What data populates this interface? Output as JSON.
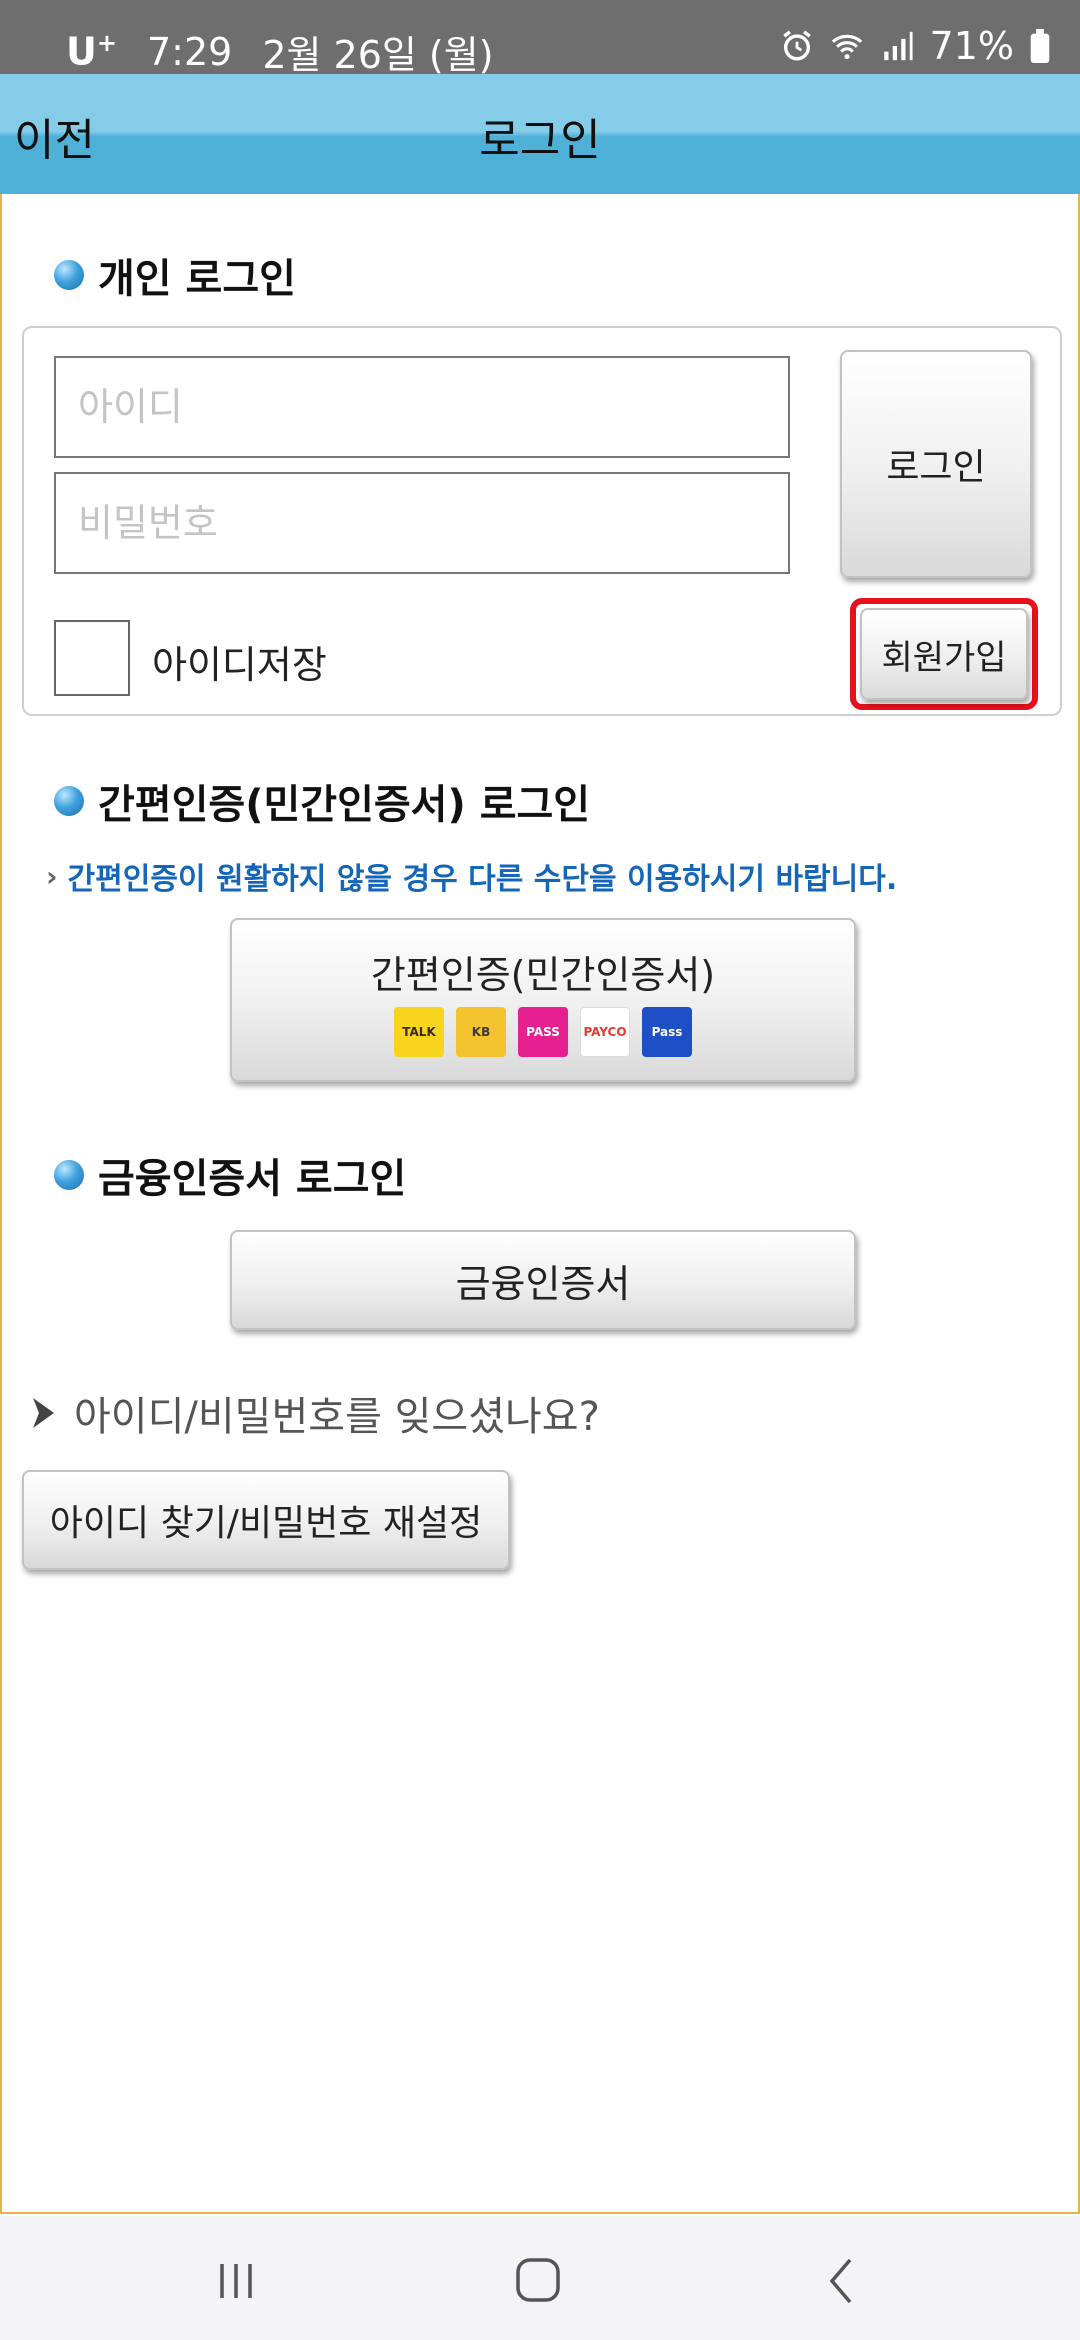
{
  "status_bar": {
    "carrier": "U",
    "carrier_sup": "+",
    "time": "7:29",
    "date": "2월 26일 (월)",
    "battery": "71%"
  },
  "header": {
    "back_label": "이전",
    "title": "로그인"
  },
  "personal_login": {
    "heading": "개인 로그인",
    "id_placeholder": "아이디",
    "password_placeholder": "비밀번호",
    "login_button": "로그인",
    "save_id_label": "아이디저장",
    "signup_button": "회원가입"
  },
  "simple_auth": {
    "heading": "간편인증(민간인증서) 로그인",
    "notice": "간편인증이 원활하지 않을 경우 다른 수단을 이용하시기 바랍니다.",
    "button_label": "간편인증(민간인증서)",
    "provider_icons": [
      {
        "name": "kakao-talk-icon",
        "text": "TALK",
        "bg": "#f7d51d",
        "fg": "#3a2a1a"
      },
      {
        "name": "kb-icon",
        "text": "KB",
        "bg": "#f4c430",
        "fg": "#3b3b3b"
      },
      {
        "name": "pass-icon",
        "text": "PASS",
        "bg": "#e6208f",
        "fg": "#ffffff"
      },
      {
        "name": "payco-icon",
        "text": "PAYCO",
        "bg": "#ffffff",
        "fg": "#e53935"
      },
      {
        "name": "samsung-pass-icon",
        "text": "Pass",
        "bg": "#1f4fc4",
        "fg": "#ffffff"
      }
    ]
  },
  "financial_cert": {
    "heading": "금융인증서 로그인",
    "button_label": "금융인증서"
  },
  "forgot": {
    "question": "아이디/비밀번호를 잊으셨나요?",
    "button_label": "아이디 찾기/비밀번호 재설정"
  },
  "colors": {
    "header_top": "#84cce8",
    "header_bottom": "#4fb1d8",
    "frame_border": "#e3b44a",
    "notice_text": "#1565b8",
    "highlight": "#e8101c"
  }
}
